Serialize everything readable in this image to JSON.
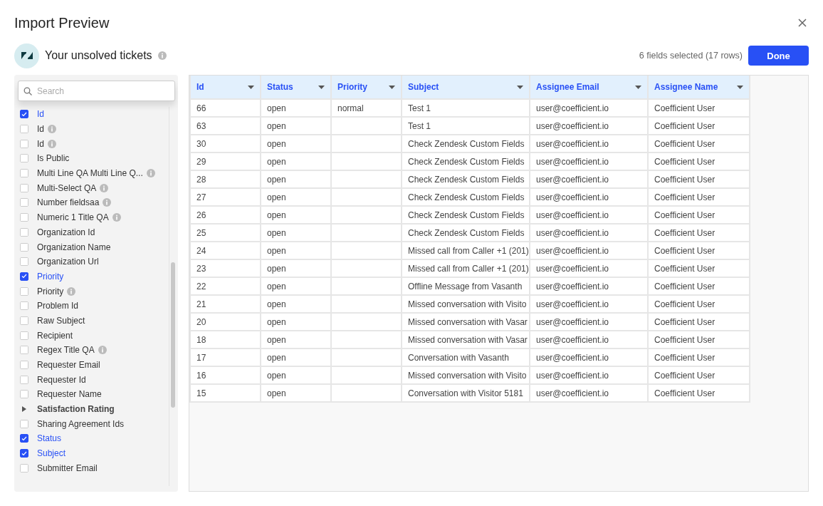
{
  "dialog": {
    "title": "Import Preview"
  },
  "source": {
    "title": "Your unsolved tickets",
    "summary": "6 fields selected (17 rows)",
    "done_label": "Done"
  },
  "search": {
    "placeholder": "Search"
  },
  "fields": [
    {
      "kind": "checkbox",
      "label": "Id",
      "checked": true,
      "info": false
    },
    {
      "kind": "checkbox",
      "label": "Id",
      "checked": false,
      "info": true
    },
    {
      "kind": "checkbox",
      "label": "Id",
      "checked": false,
      "info": true
    },
    {
      "kind": "checkbox",
      "label": "Is Public",
      "checked": false,
      "info": false
    },
    {
      "kind": "checkbox",
      "label": "Multi Line QA Multi Line Q...",
      "checked": false,
      "info": true
    },
    {
      "kind": "checkbox",
      "label": "Multi-Select QA",
      "checked": false,
      "info": true
    },
    {
      "kind": "checkbox",
      "label": "Number fieldsaa",
      "checked": false,
      "info": true
    },
    {
      "kind": "checkbox",
      "label": "Numeric 1 Title QA",
      "checked": false,
      "info": true
    },
    {
      "kind": "checkbox",
      "label": "Organization Id",
      "checked": false,
      "info": false
    },
    {
      "kind": "checkbox",
      "label": "Organization Name",
      "checked": false,
      "info": false
    },
    {
      "kind": "checkbox",
      "label": "Organization Url",
      "checked": false,
      "info": false
    },
    {
      "kind": "checkbox",
      "label": "Priority",
      "checked": true,
      "info": false
    },
    {
      "kind": "checkbox",
      "label": "Priority",
      "checked": false,
      "info": true
    },
    {
      "kind": "checkbox",
      "label": "Problem Id",
      "checked": false,
      "info": false
    },
    {
      "kind": "checkbox",
      "label": "Raw Subject",
      "checked": false,
      "info": false
    },
    {
      "kind": "checkbox",
      "label": "Recipient",
      "checked": false,
      "info": false
    },
    {
      "kind": "checkbox",
      "label": "Regex Title QA",
      "checked": false,
      "info": true
    },
    {
      "kind": "checkbox",
      "label": "Requester Email",
      "checked": false,
      "info": false
    },
    {
      "kind": "checkbox",
      "label": "Requester Id",
      "checked": false,
      "info": false
    },
    {
      "kind": "checkbox",
      "label": "Requester Name",
      "checked": false,
      "info": false
    },
    {
      "kind": "group",
      "label": "Satisfaction Rating",
      "expanded": false
    },
    {
      "kind": "checkbox",
      "label": "Sharing Agreement Ids",
      "checked": false,
      "info": false
    },
    {
      "kind": "checkbox",
      "label": "Status",
      "checked": true,
      "info": false
    },
    {
      "kind": "checkbox",
      "label": "Subject",
      "checked": true,
      "info": false
    },
    {
      "kind": "checkbox",
      "label": "Submitter Email",
      "checked": false,
      "info": false
    }
  ],
  "table": {
    "columns": [
      "Id",
      "Status",
      "Priority",
      "Subject",
      "Assignee Email",
      "Assignee Name"
    ],
    "rows": [
      [
        "66",
        "open",
        "normal",
        "Test 1",
        "user@coefficient.io",
        "Coefficient User"
      ],
      [
        "63",
        "open",
        "",
        "Test 1",
        "user@coefficient.io",
        "Coefficient User"
      ],
      [
        "30",
        "open",
        "",
        "Check Zendesk Custom Fields",
        "user@coefficient.io",
        "Coefficient User"
      ],
      [
        "29",
        "open",
        "",
        "Check Zendesk Custom Fields",
        "user@coefficient.io",
        "Coefficient User"
      ],
      [
        "28",
        "open",
        "",
        "Check Zendesk Custom Fields",
        "user@coefficient.io",
        "Coefficient User"
      ],
      [
        "27",
        "open",
        "",
        "Check Zendesk Custom Fields",
        "user@coefficient.io",
        "Coefficient User"
      ],
      [
        "26",
        "open",
        "",
        "Check Zendesk Custom Fields",
        "user@coefficient.io",
        "Coefficient User"
      ],
      [
        "25",
        "open",
        "",
        "Check Zendesk Custom Fields",
        "user@coefficient.io",
        "Coefficient User"
      ],
      [
        "24",
        "open",
        "",
        "Missed call from Caller +1 (201)",
        "user@coefficient.io",
        "Coefficient User"
      ],
      [
        "23",
        "open",
        "",
        "Missed call from Caller +1 (201)",
        "user@coefficient.io",
        "Coefficient User"
      ],
      [
        "22",
        "open",
        "",
        "Offline Message from Vasanth",
        "user@coefficient.io",
        "Coefficient User"
      ],
      [
        "21",
        "open",
        "",
        "Missed conversation with Visito",
        "user@coefficient.io",
        "Coefficient User"
      ],
      [
        "20",
        "open",
        "",
        "Missed conversation with Vasar",
        "user@coefficient.io",
        "Coefficient User"
      ],
      [
        "18",
        "open",
        "",
        "Missed conversation with Vasar",
        "user@coefficient.io",
        "Coefficient User"
      ],
      [
        "17",
        "open",
        "",
        "Conversation with Vasanth",
        "user@coefficient.io",
        "Coefficient User"
      ],
      [
        "16",
        "open",
        "",
        "Missed conversation with Visito",
        "user@coefficient.io",
        "Coefficient User"
      ],
      [
        "15",
        "open",
        "",
        "Conversation with Visitor 5181",
        "user@coefficient.io",
        "Coefficient User"
      ]
    ]
  }
}
